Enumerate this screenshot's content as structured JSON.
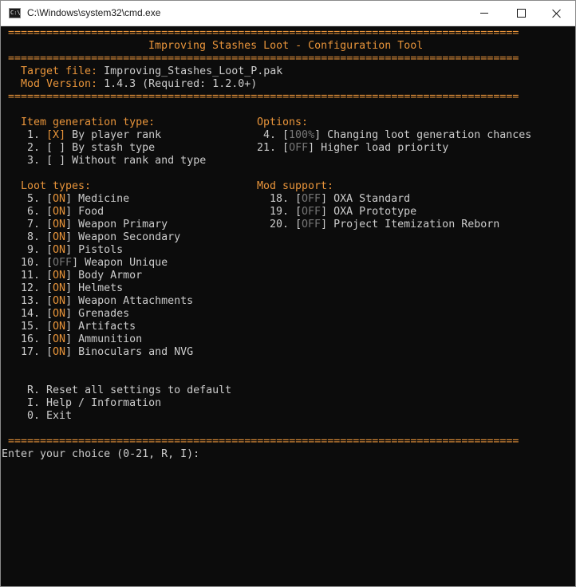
{
  "window": {
    "title": "C:\\Windows\\system32\\cmd.exe",
    "minimize_symbol": "minimize",
    "maximize_symbol": "maximize",
    "close_symbol": "close"
  },
  "header": {
    "separator": "================================================================================",
    "title": "Improving Stashes Loot - Configuration Tool",
    "target_label": "Target file:",
    "target_value": "Improving_Stashes_Loot_P.pak",
    "version_label": "Mod Version:",
    "version_value": "1.4.3 (Required: 1.2.0+)"
  },
  "item_generation": {
    "heading": "Item generation type:",
    "items": [
      {
        "num": "1.",
        "lb": "[",
        "mark": "X",
        "rb": "]",
        "label": "By player rank"
      },
      {
        "num": "2.",
        "lb": "[",
        "mark": " ",
        "rb": "]",
        "label": "By stash type"
      },
      {
        "num": "3.",
        "lb": "[",
        "mark": " ",
        "rb": "]",
        "label": "Without rank and type"
      }
    ]
  },
  "options": {
    "heading": "Options:",
    "items": [
      {
        "num": "4.",
        "lb": "[",
        "value": "100%",
        "rb": "]",
        "label": "Changing loot generation chances"
      },
      {
        "num": "21.",
        "lb": "[",
        "value": "OFF",
        "rb": "]",
        "label": "Higher load priority"
      }
    ]
  },
  "loot_types": {
    "heading": "Loot types:",
    "items": [
      {
        "num": "5.",
        "state": "ON",
        "label": "Medicine"
      },
      {
        "num": "6.",
        "state": "ON",
        "label": "Food"
      },
      {
        "num": "7.",
        "state": "ON",
        "label": "Weapon Primary"
      },
      {
        "num": "8.",
        "state": "ON",
        "label": "Weapon Secondary"
      },
      {
        "num": "9.",
        "state": "ON",
        "label": "Pistols"
      },
      {
        "num": "10.",
        "state": "OFF",
        "label": "Weapon Unique"
      },
      {
        "num": "11.",
        "state": "ON",
        "label": "Body Armor"
      },
      {
        "num": "12.",
        "state": "ON",
        "label": "Helmets"
      },
      {
        "num": "13.",
        "state": "ON",
        "label": "Weapon Attachments"
      },
      {
        "num": "14.",
        "state": "ON",
        "label": "Grenades"
      },
      {
        "num": "15.",
        "state": "ON",
        "label": "Artifacts"
      },
      {
        "num": "16.",
        "state": "ON",
        "label": "Ammunition"
      },
      {
        "num": "17.",
        "state": "ON",
        "label": "Binoculars and NVG"
      }
    ]
  },
  "mod_support": {
    "heading": "Mod support:",
    "items": [
      {
        "num": "18.",
        "state": "OFF",
        "label": "OXA Standard"
      },
      {
        "num": "19.",
        "state": "OFF",
        "label": "OXA Prototype"
      },
      {
        "num": "20.",
        "state": "OFF",
        "label": "Project Itemization Reborn"
      }
    ]
  },
  "commands": [
    {
      "key": "R.",
      "label": "Reset all settings to default"
    },
    {
      "key": "I.",
      "label": "Help / Information"
    },
    {
      "key": "0.",
      "label": "Exit"
    }
  ],
  "prompt": "Enter your choice (0-21, R, I):",
  "colors": {
    "accent": "#e8943a",
    "text": "#cccccc",
    "dim": "#767676",
    "background": "#0c0c0c"
  }
}
